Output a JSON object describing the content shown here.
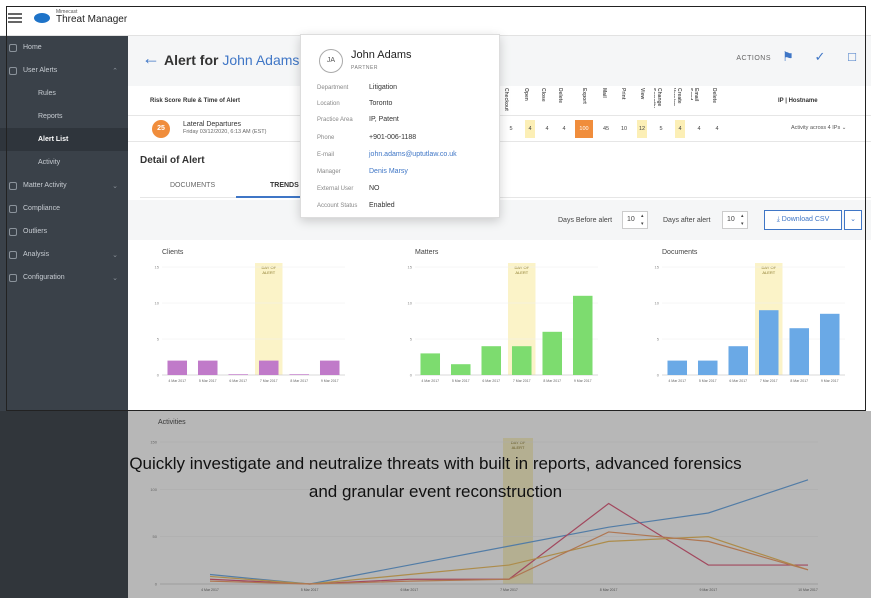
{
  "app": {
    "brand_small": "Mimecast",
    "brand_name": "Threat Manager"
  },
  "sidebar": {
    "items": [
      {
        "label": "Home"
      },
      {
        "label": "User Alerts"
      },
      {
        "label": "Rules"
      },
      {
        "label": "Reports"
      },
      {
        "label": "Alert List"
      },
      {
        "label": "Activity"
      },
      {
        "label": "Matter Activity"
      },
      {
        "label": "Compliance"
      },
      {
        "label": "Outliers"
      },
      {
        "label": "Analysis"
      },
      {
        "label": "Configuration"
      }
    ]
  },
  "header": {
    "title_prefix": "Alert for",
    "title_name": "John Adams",
    "actions_label": "ACTIONS"
  },
  "table": {
    "headers": {
      "risk": "Risk Score",
      "rule": "Rule & Time of Alert",
      "ip": "IP | Hostname"
    },
    "vertical_headers": [
      "Checkout",
      "Open",
      "Close",
      "Delete",
      "Export",
      "Mail",
      "Print",
      "View",
      "Change Security",
      "Create Version",
      "Email Send",
      "Delete"
    ],
    "row": {
      "risk": "25",
      "rule": "Lateral Departures",
      "time": "Friday 03/12/2020, 6:13 AM (EST)",
      "cells": [
        "5",
        "4",
        "4",
        "4",
        "100",
        "45",
        "10",
        "12",
        "5",
        "4",
        "4",
        "4"
      ],
      "activity": "Activity across 4 IPs"
    }
  },
  "detail": {
    "title": "Detail of Alert",
    "tabs": [
      "DOCUMENTS",
      "TRENDS"
    ]
  },
  "toolbar": {
    "days_before_label": "Days Before alert",
    "days_before_value": "10",
    "days_after_label": "Days after alert",
    "days_after_value": "10",
    "download_label": "Download CSV"
  },
  "chart_data": [
    {
      "type": "bar",
      "title": "Clients",
      "categories": [
        "4 Mar 2017",
        "5 Mar 2017",
        "6 Mar 2017",
        "7 Mar 2017",
        "8 Mar 2017",
        "9 Mar 2017"
      ],
      "values": [
        2,
        2,
        0.1,
        2,
        0.1,
        2
      ],
      "y_ticks": [
        "15",
        "10",
        "5",
        "0"
      ],
      "ylim": [
        0,
        15
      ],
      "highlight_label": [
        "DAY OF",
        "ALERT"
      ],
      "highlight_index": 3,
      "color": "#c07ac9"
    },
    {
      "type": "bar",
      "title": "Matters",
      "categories": [
        "4 Mar 2017",
        "5 Mar 2017",
        "6 Mar 2017",
        "7 Mar 2017",
        "8 Mar 2017",
        "9 Mar 2017"
      ],
      "values": [
        3,
        1.5,
        4,
        4,
        6,
        11
      ],
      "y_ticks": [
        "15",
        "10",
        "5",
        "0"
      ],
      "ylim": [
        0,
        15
      ],
      "highlight_label": [
        "DAY OF",
        "ALERT"
      ],
      "highlight_index": 3,
      "color": "#7ddc6f"
    },
    {
      "type": "bar",
      "title": "Documents",
      "categories": [
        "4 Mar 2017",
        "5 Mar 2017",
        "6 Mar 2017",
        "7 Mar 2017",
        "8 Mar 2017",
        "9 Mar 2017"
      ],
      "values": [
        2,
        2,
        4,
        9,
        6.5,
        8.5
      ],
      "y_ticks": [
        "15",
        "10",
        "5",
        "0"
      ],
      "ylim": [
        0,
        15
      ],
      "highlight_label": [
        "DAY OF",
        "ALERT"
      ],
      "highlight_index": 3,
      "color": "#6aa9e6"
    },
    {
      "type": "line",
      "title": "Activities",
      "categories": [
        "4 Mar 2017",
        "5 Mar 2017",
        "6 Mar 2017",
        "7 Mar 2017",
        "8 Mar 2017",
        "9 Mar 2017",
        "10 Mar 2017"
      ],
      "y_ticks": [
        "150",
        "100",
        "50",
        "0"
      ],
      "ylim": [
        0,
        150
      ],
      "highlight_label": [
        "DAY OF",
        "ALERT"
      ],
      "highlight_index": 3,
      "series": [
        {
          "values": [
            10,
            0,
            20,
            40,
            60,
            75,
            110
          ],
          "color": "#6aa9e6"
        },
        {
          "values": [
            5,
            0,
            5,
            5,
            85,
            20,
            20
          ],
          "color": "#e05c7c"
        },
        {
          "values": [
            8,
            0,
            10,
            20,
            45,
            50,
            15
          ],
          "color": "#f0c060"
        },
        {
          "values": [
            3,
            0,
            3,
            5,
            55,
            45,
            15
          ],
          "color": "#f3a06a"
        }
      ]
    }
  ],
  "popover": {
    "initials": "JA",
    "name": "John Adams",
    "role": "PARTNER",
    "fields": [
      {
        "key": "Department",
        "value": "Litigation"
      },
      {
        "key": "Location",
        "value": "Toronto"
      },
      {
        "key": "Practice Area",
        "value": "IP, Patent"
      },
      {
        "key": "Phone",
        "value": "+901-006-1188"
      },
      {
        "key": "E-mail",
        "value": "john.adams@uptutlaw.co.uk"
      },
      {
        "key": "Manager",
        "value": "Denis Marsy"
      },
      {
        "key": "External User",
        "value": "NO"
      },
      {
        "key": "Account Status",
        "value": "Enabled"
      }
    ]
  },
  "caption": {
    "line1": "Quickly investigate and neutralize threats with built in reports, advanced forensics",
    "line2": "and granular event reconstruction"
  }
}
